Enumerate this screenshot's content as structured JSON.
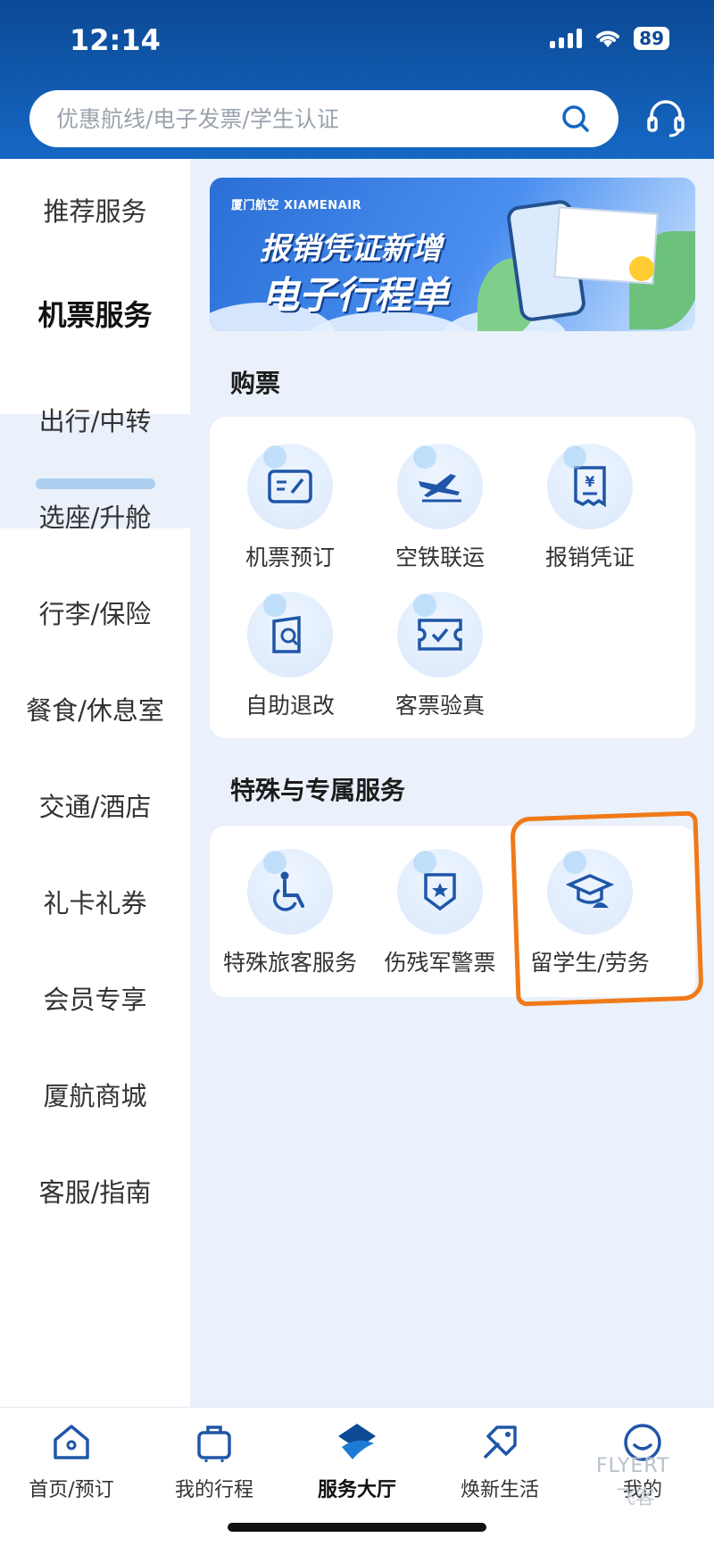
{
  "status": {
    "time": "12:14",
    "battery": "89"
  },
  "search": {
    "placeholder": "优惠航线/电子发票/学生认证"
  },
  "sidebar": {
    "items": [
      {
        "label": "推荐服务"
      },
      {
        "label": "机票服务"
      },
      {
        "label": "出行/中转"
      },
      {
        "label": "选座/升舱"
      },
      {
        "label": "行李/保险"
      },
      {
        "label": "餐食/休息室"
      },
      {
        "label": "交通/酒店"
      },
      {
        "label": "礼卡礼券"
      },
      {
        "label": "会员专享"
      },
      {
        "label": "厦航商城"
      },
      {
        "label": "客服/指南"
      }
    ],
    "active_index": 1
  },
  "banner": {
    "logo": "厦门航空 XIAMENAIR",
    "line1": "报销凭证新增",
    "line2": "电子行程单"
  },
  "sections": [
    {
      "title": "购票",
      "items": [
        {
          "label": "机票预订",
          "icon": "ticket-icon"
        },
        {
          "label": "空铁联运",
          "icon": "plane-train-icon"
        },
        {
          "label": "报销凭证",
          "icon": "receipt-icon"
        },
        {
          "label": "自助退改",
          "icon": "refund-icon"
        },
        {
          "label": "客票验真",
          "icon": "verify-ticket-icon"
        }
      ]
    },
    {
      "title": "特殊与专属服务",
      "items": [
        {
          "label": "特殊旅客服务",
          "icon": "wheelchair-icon"
        },
        {
          "label": "伤残军警票",
          "icon": "badge-icon"
        },
        {
          "label": "留学生/劳务",
          "icon": "graduation-cap-icon"
        }
      ]
    }
  ],
  "bottom_nav": [
    {
      "label": "首页/预订",
      "icon": "home-icon"
    },
    {
      "label": "我的行程",
      "icon": "luggage-icon"
    },
    {
      "label": "服务大厅",
      "icon": "service-hall-icon"
    },
    {
      "label": "焕新生活",
      "icon": "lifestyle-icon"
    },
    {
      "label": "我的",
      "icon": "profile-icon"
    }
  ],
  "watermark": {
    "brand": "FLYERT",
    "sub": "飞客"
  },
  "colors": {
    "brand_blue": "#1667c4",
    "highlight": "#f07a18"
  }
}
